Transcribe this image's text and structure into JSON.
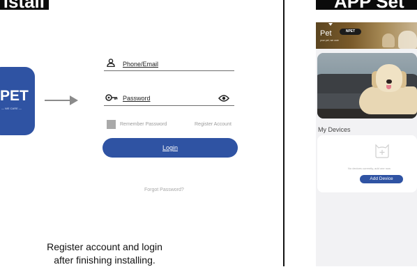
{
  "banners": {
    "left": "istall",
    "right": "APP Set"
  },
  "app_icon": {
    "text": "PET",
    "subtext": "— WE CARE —"
  },
  "login": {
    "phone_label": "Phone/Email",
    "password_label": "Password",
    "remember_label": "Remember Password",
    "register_label": "Register Account",
    "login_button": "Login",
    "forgot_label": "Forgot Password?"
  },
  "caption": {
    "line1": "Register account and login",
    "line2": "after finishing installing."
  },
  "app": {
    "header_title": "Pet",
    "header_tagline": "your pet, we care",
    "brand_badge": "NPET",
    "my_devices_label": "My Devices",
    "empty_text": "No devices currently, add one now",
    "add_device_button": "Add Device"
  },
  "icons": {
    "phone": "user-icon",
    "password": "key-icon",
    "visibility": "eye-icon",
    "placeholder": "device-add-icon"
  },
  "colors": {
    "brand_blue": "#2f53a3",
    "banner_black": "#0b0b0b",
    "muted_gray": "#9b9b9b"
  }
}
